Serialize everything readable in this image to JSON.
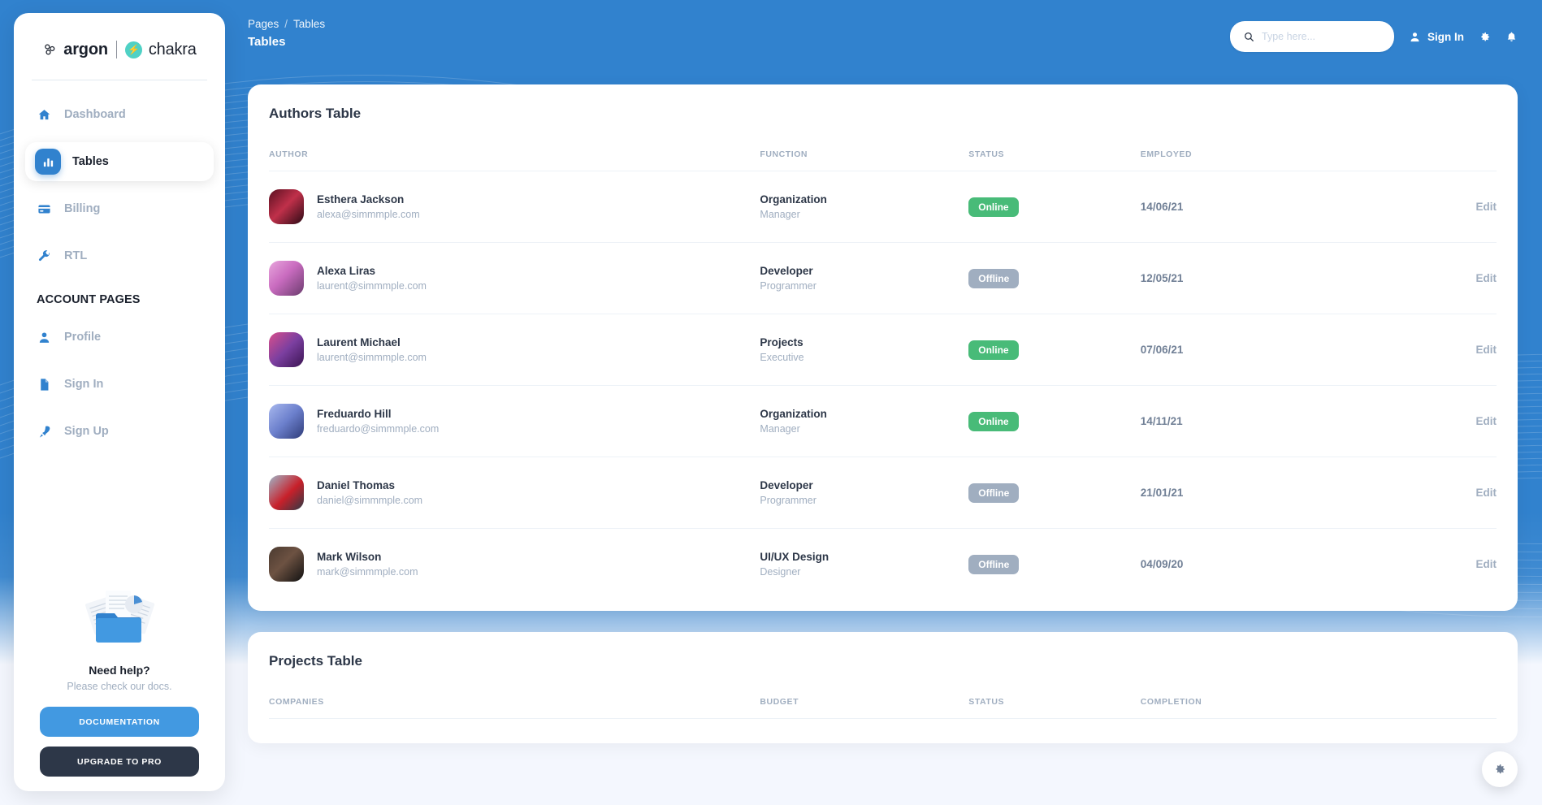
{
  "brand": {
    "argon": "argon",
    "chakra": "chakra",
    "chakra_icon": "lightning-bolt-icon"
  },
  "sidebar": {
    "items": [
      {
        "label": "Dashboard",
        "icon": "home-icon",
        "active": false
      },
      {
        "label": "Tables",
        "icon": "chart-bar-icon",
        "active": true
      },
      {
        "label": "Billing",
        "icon": "credit-card-icon",
        "active": false
      },
      {
        "label": "RTL",
        "icon": "wrench-icon",
        "active": false
      }
    ],
    "section_label": "ACCOUNT PAGES",
    "account_items": [
      {
        "label": "Profile",
        "icon": "person-icon"
      },
      {
        "label": "Sign In",
        "icon": "document-icon"
      },
      {
        "label": "Sign Up",
        "icon": "rocket-icon"
      }
    ],
    "help": {
      "art_icon": "folder-documents-icon",
      "title": "Need help?",
      "subtitle": "Please check our docs.",
      "documentation_label": "DOCUMENTATION",
      "upgrade_label": "UPGRADE TO PRO"
    }
  },
  "topbar": {
    "breadcrumb_root": "Pages",
    "breadcrumb_sep": "/",
    "breadcrumb_current": "Tables",
    "page_title": "Tables",
    "search_placeholder": "Type here...",
    "search_value": "",
    "search_icon": "search-icon",
    "signin_label": "Sign In",
    "signin_icon": "person-icon",
    "settings_icon": "gear-icon",
    "notifications_icon": "bell-icon"
  },
  "authors_table": {
    "title": "Authors Table",
    "columns": [
      "AUTHOR",
      "FUNCTION",
      "STATUS",
      "EMPLOYED",
      ""
    ],
    "action_label": "Edit",
    "rows": [
      {
        "name": "Esthera Jackson",
        "email": "alexa@simmmple.com",
        "function": "Organization",
        "role": "Manager",
        "status": "Online",
        "employed": "14/06/21",
        "action": "Edit",
        "avatar_colors": [
          "#5a1021",
          "#c0304a",
          "#2b0a14"
        ]
      },
      {
        "name": "Alexa Liras",
        "email": "laurent@simmmple.com",
        "function": "Developer",
        "role": "Programmer",
        "status": "Offline",
        "employed": "12/05/21",
        "action": "Edit",
        "avatar_colors": [
          "#c96bbf",
          "#6b3c6e",
          "#e8a6dd"
        ]
      },
      {
        "name": "Laurent Michael",
        "email": "laurent@simmmple.com",
        "function": "Projects",
        "role": "Executive",
        "status": "Online",
        "employed": "07/06/21",
        "action": "Edit",
        "avatar_colors": [
          "#7b3fa0",
          "#d94f8c",
          "#3b1452"
        ]
      },
      {
        "name": "Freduardo Hill",
        "email": "freduardo@simmmple.com",
        "function": "Organization",
        "role": "Manager",
        "status": "Online",
        "employed": "14/11/21",
        "action": "Edit",
        "avatar_colors": [
          "#8ea2e8",
          "#5a6fc0",
          "#2f3c78"
        ]
      },
      {
        "name": "Daniel Thomas",
        "email": "daniel@simmmple.com",
        "function": "Developer",
        "role": "Programmer",
        "status": "Offline",
        "employed": "21/01/21",
        "action": "Edit",
        "avatar_colors": [
          "#9fb6c9",
          "#c8202a",
          "#2b3a46"
        ]
      },
      {
        "name": "Mark Wilson",
        "email": "mark@simmmple.com",
        "function": "UI/UX Design",
        "role": "Designer",
        "status": "Offline",
        "employed": "04/09/20",
        "action": "Edit",
        "avatar_colors": [
          "#2b2b2b",
          "#6d5242",
          "#111111"
        ]
      }
    ]
  },
  "projects_table": {
    "title": "Projects Table",
    "columns": [
      "COMPANIES",
      "BUDGET",
      "STATUS",
      "COMPLETION"
    ]
  },
  "fab": {
    "icon": "gear-icon"
  },
  "colors": {
    "brand_blue": "#3182ce",
    "accent_blue": "#4299e1",
    "status_online": "#48bb78",
    "status_offline": "#a0aec0",
    "dark": "#2d3748",
    "muted": "#a0aec0",
    "page_bg": "#f4f7fe"
  }
}
